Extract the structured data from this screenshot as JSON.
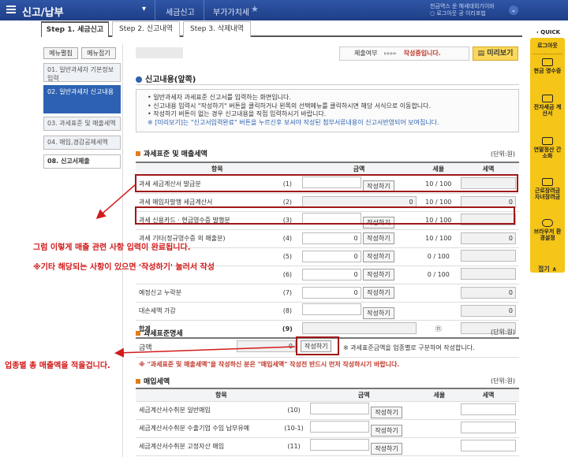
{
  "topbar": {
    "title": "신고/납부",
    "caret": "▾",
    "crumb1": "세금신고",
    "crumb2": "부가가치세",
    "star": "★",
    "right_line1": "천금역스 운 해세대외기이바",
    "right_line2": "○ 로그아웃 공 이리포법",
    "toggle": "⌄"
  },
  "tabs": [
    {
      "label": "Step 1. 세금신고"
    },
    {
      "label": "Step 2. 신고내역"
    },
    {
      "label": "Step 3. 삭제내역"
    }
  ],
  "sidebar": {
    "open_label": "메뉴펼침",
    "close_label": "메뉴접기",
    "steps": [
      {
        "label": "01. 일반과세자 기본정보 입력"
      },
      {
        "label": "02. 일반과세자 신고내용"
      },
      {
        "label": "03. 과세표준 및 매출세액"
      },
      {
        "label": "04. 매입,경감공제세액"
      },
      {
        "label": "08. 신고서제출"
      }
    ]
  },
  "status": {
    "label": "제출여부",
    "arrows": "▸▸▸▸",
    "value": "작성중입니다."
  },
  "preview_button": "미리보기",
  "section1": {
    "title": "신고내용(앞쪽)",
    "info": [
      "• 일반과세자 과세표준 신고서를 입력하는 화면입니다.",
      "• 신고내용 입력시 \"작성하기\" 버튼을 클릭하거나 왼쪽의 선택메뉴를 클릭하시면 해당 서식으로 이동합니다.",
      "• 작성하기 버튼이 없는 경우 신고내용을 직접 입력하시기 바랍니다.",
      "※ [미리보기]는 \"신고서입력완료\" 버튼을 누르신후 보셔야 작성된 첨부서류내용이 신고서반영되어 보여집니다."
    ]
  },
  "section2": {
    "title": "과세표준 및 매출세액",
    "unit": "(단위:원)",
    "headers": [
      "항목",
      "금액",
      "세율",
      "세액"
    ],
    "rows": [
      {
        "label": "과세 세금계산서 발급분",
        "no": "(1)",
        "amount": "",
        "btn": "작성하기",
        "rate": "10 / 100",
        "tax": ""
      },
      {
        "label": "과세 매입자발행 세금계산서",
        "no": "(2)",
        "amount": "0",
        "btn": "",
        "rate": "10 / 100",
        "tax": "0"
      },
      {
        "label": "과세 신용카드 · 현금영수증 발행분",
        "no": "(3)",
        "amount": "",
        "btn": "작성하기",
        "rate": "10 / 100",
        "tax": ""
      },
      {
        "label": "과세 기타(정규영수증 외 매출분)",
        "no": "(4)",
        "amount": "0",
        "btn": "작성하기",
        "rate": "10 / 100",
        "tax": "0"
      },
      {
        "label": "",
        "no": "(5)",
        "amount": "0",
        "btn": "작성하기",
        "rate": "0 / 100",
        "tax": ""
      },
      {
        "label": "",
        "no": "(6)",
        "amount": "0",
        "btn": "작성하기",
        "rate": "0 / 100",
        "tax": ""
      },
      {
        "label": "예정신고 누락분",
        "no": "(7)",
        "amount": "0",
        "btn": "작성하기",
        "rate": "",
        "tax": "0"
      },
      {
        "label": "대손세액 가감",
        "no": "(8)",
        "amount": "",
        "btn": "작성하기",
        "rate": "",
        "tax": "0"
      },
      {
        "label": "합계",
        "no": "(9)",
        "amount": "",
        "btn": "",
        "rate": "⑪",
        "tax": ""
      }
    ]
  },
  "section3": {
    "title": "과세표준명세",
    "unit": "(단위:원)",
    "row_label": "금액",
    "amount": "0",
    "btn": "작성하기",
    "note": "※ 과세표준금액을 업종별로 구분하여 작성합니다.",
    "warning": "※ \"과세표준 및 매출세액\"을 작성하신 분은 \"매입세액\" 작성전 반드시 먼저 작성하시기 바랍니다."
  },
  "section4": {
    "title": "매입세액",
    "unit": "(단위:원)",
    "headers": [
      "항목",
      "금액",
      "세율",
      "세액"
    ],
    "rows": [
      {
        "label": "세금계산서수취분 일반매입",
        "no": "(10)",
        "btn": "작성하기"
      },
      {
        "label": "세금계산서수취분 수출기업 수입 납부유예",
        "no": "(10-1)",
        "btn": "작성하기"
      },
      {
        "label": "세금계산서수취분 고정자산 매입",
        "no": "(11)",
        "btn": "작성하기"
      }
    ]
  },
  "annotations": {
    "a1": "그럼 이렇게 매출 관련 사항 입력이 완료됩니다.",
    "a2": "※기타 해당되는 사항이 있으면 '작성하기' 눌러서 작성",
    "a3": "업종별 총 매출액을 적을겁니다.",
    "color": "#d21b1b"
  },
  "quick": {
    "title": "QUICK",
    "items": [
      "로그아웃",
      "현금 영수증",
      "전자세금 계산서",
      "연말정산 간소화",
      "근로장려금 자녀장려금",
      "브라우저 환경설정"
    ],
    "close": "접기 ∧"
  }
}
